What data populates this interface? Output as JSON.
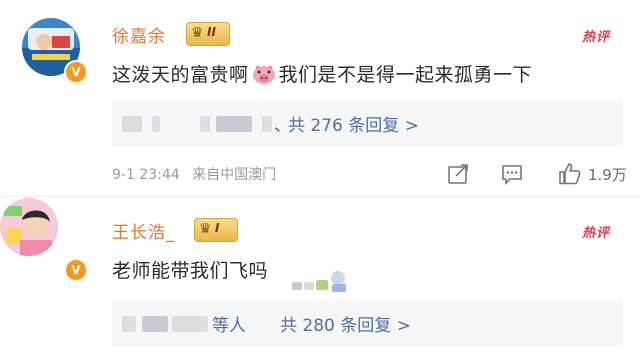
{
  "comments": [
    {
      "username": "徐嘉余",
      "rank_level": "II",
      "hot_label": "热评",
      "verified": "V",
      "text": "这泼天的富贵啊",
      "text_after_emoji": "我们是不是得一起来孤勇一下",
      "reply_separator": "、",
      "reply_summary": "共 276 条回复 >",
      "timestamp": "9-1 23:44",
      "location": "来自中国澳门",
      "like_count": "1.9万",
      "icons": [
        "share-icon",
        "comment-icon",
        "like-icon"
      ]
    },
    {
      "username": "王长浩_",
      "rank_level": "I",
      "hot_label": "热评",
      "verified": "V",
      "text": "老师能带我们飞吗",
      "reply_prefix": "等人",
      "reply_summary": "共 280 条回复 >"
    }
  ],
  "colors": {
    "username": "#e8742a",
    "link": "#4b6ea8",
    "hot": "#e6394a",
    "verified_badge": "#f39a1e"
  }
}
